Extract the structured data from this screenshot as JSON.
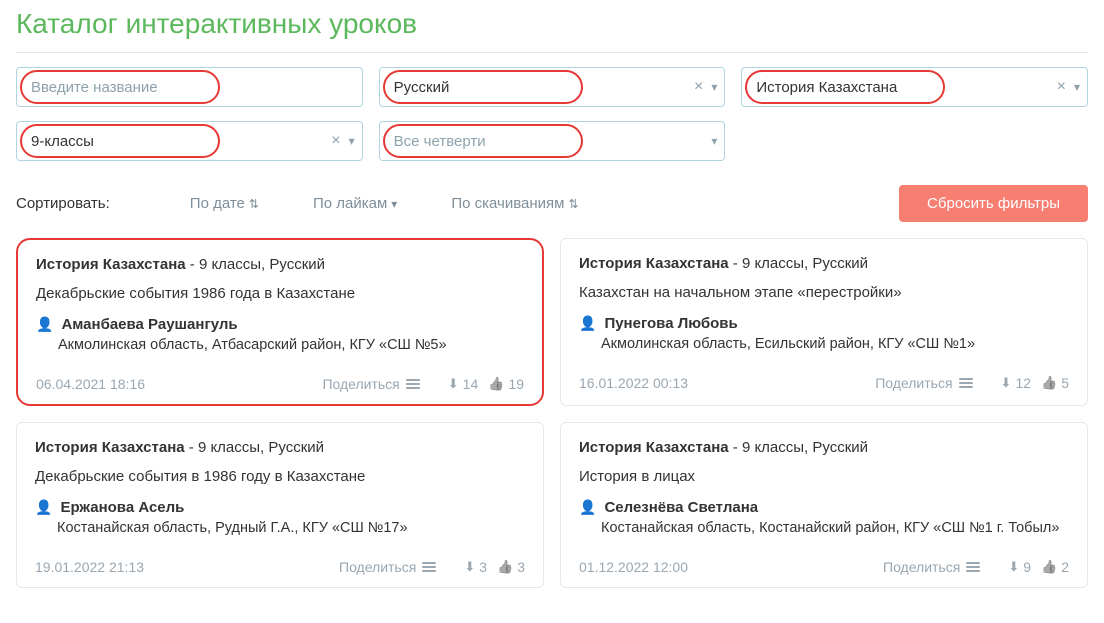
{
  "page": {
    "title": "Каталог интерактивных уроков"
  },
  "filters": {
    "name_placeholder": "Введите название",
    "language": "Русский",
    "subject": "История Казахстана",
    "grade": "9-классы",
    "quarter_placeholder": "Все четверти"
  },
  "sort": {
    "label": "Сортировать:",
    "by_date": "По дате",
    "by_likes": "По лайкам",
    "by_downloads": "По скачиваниям"
  },
  "reset_label": "Сбросить фильтры",
  "share_label": "Поделиться",
  "cards": [
    {
      "subject": "История Казахстана",
      "meta": " - 9 классы, Русский",
      "title": "Декабрьские события 1986 года в Казахстане",
      "author": "Аманбаева Раушангуль",
      "location": "Акмолинская область, Атбасарский район, КГУ «СШ №5»",
      "date": "06.04.2021 18:16",
      "downloads": "14",
      "likes": "19"
    },
    {
      "subject": "История Казахстана",
      "meta": " - 9 классы, Русский",
      "title": "Казахстан на начальном этапе «перестройки»",
      "author": "Пунегова Любовь",
      "location": "Акмолинская область, Есильский район, КГУ «СШ №1»",
      "date": "16.01.2022 00:13",
      "downloads": "12",
      "likes": "5"
    },
    {
      "subject": "История Казахстана",
      "meta": " - 9 классы, Русский",
      "title": "Декабрьские события в 1986 году в Казахстане",
      "author": "Ержанова Асель",
      "location": "Костанайская область, Рудный Г.А., КГУ «СШ №17»",
      "date": "19.01.2022 21:13",
      "downloads": "3",
      "likes": "3"
    },
    {
      "subject": "История Казахстана",
      "meta": " - 9 классы, Русский",
      "title": "История в лицах",
      "author": "Селезнёва Светлана",
      "location": "Костанайская область, Костанайский район, КГУ «СШ №1 г. Тобыл»",
      "date": "01.12.2022 12:00",
      "downloads": "9",
      "likes": "2"
    }
  ]
}
